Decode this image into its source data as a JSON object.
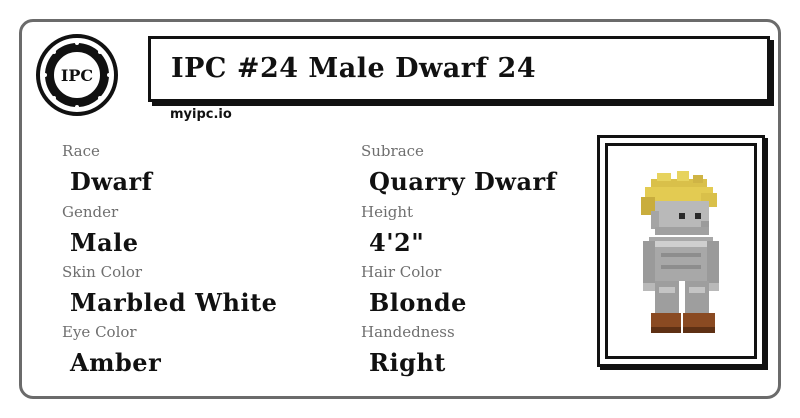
{
  "card": {
    "title": "IPC #24 Male Dwarf 24",
    "site": "myipc.io",
    "logo_text": "IPC"
  },
  "fields": {
    "race_label": "Race",
    "race_value": "Dwarf",
    "subrace_label": "Subrace",
    "subrace_value": "Quarry Dwarf",
    "gender_label": "Gender",
    "gender_value": "Male",
    "height_label": "Height",
    "height_value": "4'2\"",
    "skin_label": "Skin Color",
    "skin_value": "Marbled White",
    "hair_label": "Hair Color",
    "hair_value": "Blonde",
    "eye_label": "Eye Color",
    "eye_value": "Amber",
    "hand_label": "Handedness",
    "hand_value": "Right"
  },
  "colors": {
    "border": "#6b6b6b",
    "label": "#6f6f6f",
    "hair": "#d9c04a",
    "skin": "#b9b9b9",
    "boots": "#8a4a22"
  },
  "icons": {
    "logo": "ipc-seal-logo",
    "portrait": "dwarf-character-sprite"
  }
}
